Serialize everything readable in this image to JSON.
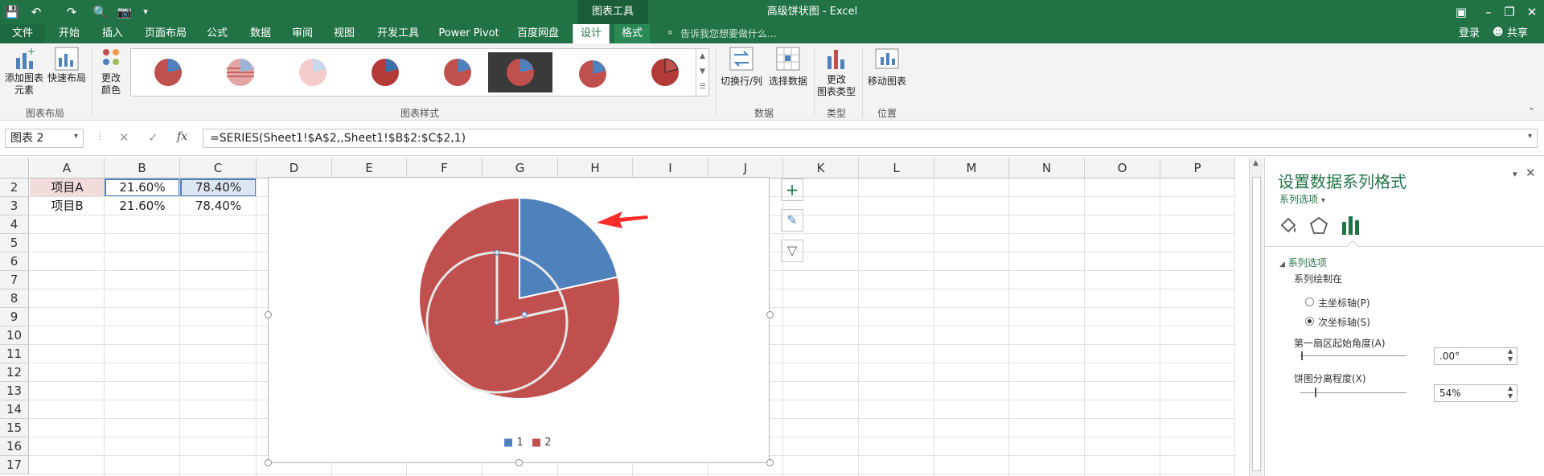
{
  "app": {
    "title": "高级饼状图 - Excel",
    "context_label": "图表工具"
  },
  "tabs": [
    {
      "label": "文件"
    },
    {
      "label": "开始"
    },
    {
      "label": "插入"
    },
    {
      "label": "页面布局"
    },
    {
      "label": "公式"
    },
    {
      "label": "数据"
    },
    {
      "label": "审阅"
    },
    {
      "label": "视图"
    },
    {
      "label": "开发工具"
    },
    {
      "label": "Power Pivot"
    },
    {
      "label": "百度网盘"
    },
    {
      "label": "设计"
    },
    {
      "label": "格式"
    }
  ],
  "tell_me": "告诉我您想要做什么...",
  "account": {
    "login": "登录",
    "share": "共享"
  },
  "ribbon": {
    "add_element": "添加图表\n元素",
    "quick_layout": "快速布局",
    "change_color": "更改\n颜色",
    "group_layouts": "图表布局",
    "group_styles": "图表样式",
    "switch_row_col": "切换行/列",
    "select_data": "选择数据",
    "group_data": "数据",
    "change_type": "更改\n图表类型",
    "group_type": "类型",
    "move_chart": "移动图表",
    "group_location": "位置"
  },
  "formula_bar": {
    "name_box": "图表 2",
    "formula": "=SERIES(Sheet1!$A$2,,Sheet1!$B$2:$C$2,1)",
    "fx": "fx"
  },
  "columns": [
    "A",
    "B",
    "C",
    "D",
    "E",
    "F",
    "G",
    "H",
    "I",
    "J",
    "K",
    "L",
    "M",
    "N",
    "O",
    "P"
  ],
  "rows": [
    "2",
    "3",
    "4",
    "5",
    "6",
    "7",
    "8",
    "9",
    "10",
    "11",
    "12",
    "13",
    "14",
    "15",
    "16",
    "17"
  ],
  "cells": {
    "A2": "项目A",
    "B2": "21.60%",
    "C2": "78.40%",
    "A3": "项目B",
    "B3": "21.60%",
    "C3": "78.40%"
  },
  "chart_data": {
    "type": "pie",
    "categories": [
      "1",
      "2"
    ],
    "series": [
      {
        "values": [
          21.6,
          78.4
        ]
      },
      {
        "values": [
          21.6,
          78.4
        ]
      }
    ],
    "colors": [
      "#4f81bd",
      "#c0504d"
    ],
    "legend": "bottom",
    "explosion_percent": 54
  },
  "pane": {
    "title": "设置数据系列格式",
    "subtitle": "系列选项",
    "section": "系列选项",
    "plot_on": "系列绘制在",
    "primary_axis": "主坐标轴(P)",
    "secondary_axis": "次坐标轴(S)",
    "first_angle_label": "第一扇区起始角度(A)",
    "first_angle_value": ".00°",
    "explosion_label": "饼图分离程度(X)",
    "explosion_value": "54%",
    "selected_axis": "secondary"
  }
}
